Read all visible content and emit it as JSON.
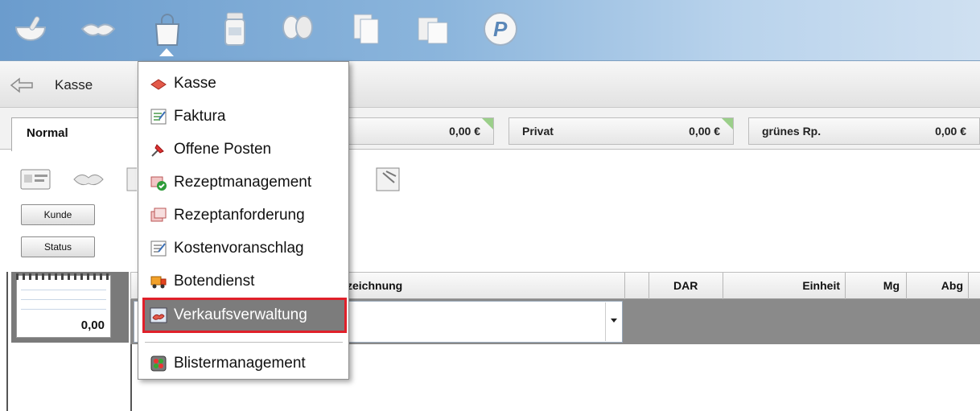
{
  "toolbar": {
    "icons": [
      "mortar-pestle-icon",
      "handshake-icon",
      "shopping-bag-icon",
      "medicine-bottle-icon",
      "heads-icon",
      "documents-icon",
      "files-icon",
      "p-logo-icon"
    ],
    "active": "shopping-bag-icon"
  },
  "nav": {
    "title": "Kasse"
  },
  "tabs": {
    "active": "Normal"
  },
  "sums": [
    {
      "label": "",
      "amount": "0,00 €"
    },
    {
      "label": "Privat",
      "amount": "0,00 €"
    },
    {
      "label": "grünes Rp.",
      "amount": "0,00 €"
    }
  ],
  "buttons": {
    "kunde": "Kunde",
    "status": "Status"
  },
  "notepad": {
    "value": "0,00"
  },
  "grid": {
    "columns": [
      "zeichnung",
      "DAR",
      "Einheit",
      "Mg",
      "Abg"
    ]
  },
  "menu": {
    "items": [
      {
        "label": "Kasse",
        "icon": "cash-register-icon"
      },
      {
        "label": "Faktura",
        "icon": "invoice-icon"
      },
      {
        "label": "Offene Posten",
        "icon": "pin-icon"
      },
      {
        "label": "Rezeptmanagement",
        "icon": "prescription-check-icon"
      },
      {
        "label": "Rezeptanforderung",
        "icon": "prescription-request-icon"
      },
      {
        "label": "Kostenvoranschlag",
        "icon": "estimate-icon"
      },
      {
        "label": "Botendienst",
        "icon": "delivery-truck-icon"
      },
      {
        "label": "Verkaufsverwaltung",
        "icon": "sales-admin-icon"
      },
      {
        "label": "Blistermanagement",
        "icon": "blister-icon"
      }
    ],
    "selected": "Verkaufsverwaltung"
  },
  "colors": {
    "toolbar": "#6b9ccd",
    "selection_outline": "#e0202a",
    "selected_bg": "#7c7c7c"
  }
}
